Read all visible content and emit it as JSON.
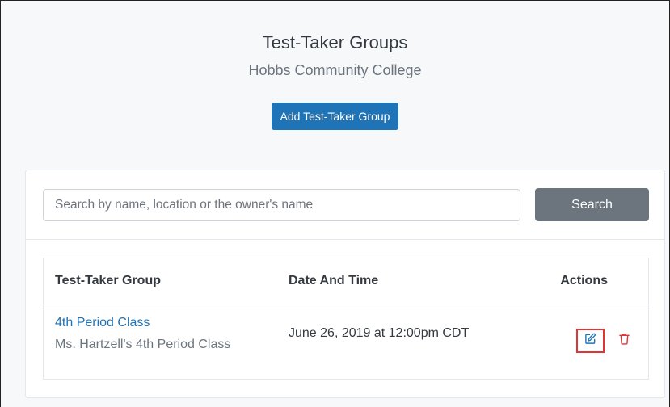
{
  "header": {
    "title": "Test-Taker Groups",
    "subtitle": "Hobbs Community College",
    "add_button_label": "Add Test-Taker Group"
  },
  "search": {
    "placeholder": "Search by name, location or the owner's name",
    "value": "",
    "button_label": "Search"
  },
  "table": {
    "columns": [
      "Test-Taker Group",
      "Date And Time",
      "Actions"
    ],
    "rows": [
      {
        "name": "4th Period Class",
        "description": "Ms. Hartzell's 4th Period Class",
        "date": "June 26, 2019 at 12:00pm CDT",
        "actions": [
          "edit-icon",
          "trash-icon"
        ]
      }
    ]
  },
  "colors": {
    "primary": "#1f73b7",
    "secondary": "#6c757d",
    "danger": "#e03535"
  }
}
